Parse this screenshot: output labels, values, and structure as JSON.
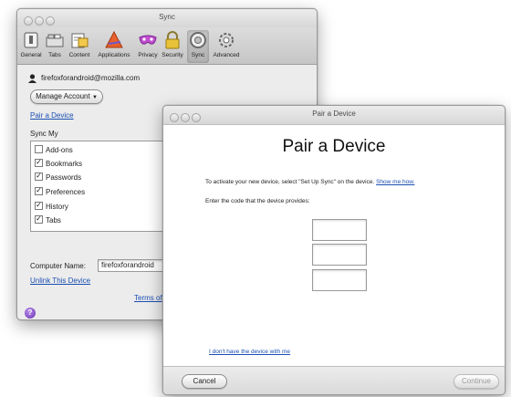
{
  "prefs": {
    "title": "Sync",
    "toolbar": [
      {
        "label": "General",
        "icon": "general-icon"
      },
      {
        "label": "Tabs",
        "icon": "tabs-icon"
      },
      {
        "label": "Content",
        "icon": "content-icon"
      },
      {
        "label": "Applications",
        "icon": "applications-icon"
      },
      {
        "label": "Privacy",
        "icon": "privacy-icon"
      },
      {
        "label": "Security",
        "icon": "security-icon"
      },
      {
        "label": "Sync",
        "icon": "sync-icon",
        "selected": true
      },
      {
        "label": "Advanced",
        "icon": "advanced-icon"
      }
    ],
    "account_email": "firefoxforandroid@mozilla.com",
    "manage_account_label": "Manage Account",
    "pair_device_link": "Pair a Device",
    "sync_my_label": "Sync My",
    "sync_items": [
      {
        "label": "Add-ons",
        "checked": false
      },
      {
        "label": "Bookmarks",
        "checked": true
      },
      {
        "label": "Passwords",
        "checked": true
      },
      {
        "label": "Preferences",
        "checked": true
      },
      {
        "label": "History",
        "checked": true
      },
      {
        "label": "Tabs",
        "checked": true
      }
    ],
    "computer_name_label": "Computer Name:",
    "computer_name_value": "firefoxforandroid",
    "unlink_link": "Unlink This Device",
    "terms_link": "Terms of",
    "help_label": "?"
  },
  "pair": {
    "title": "Pair a Device",
    "heading": "Pair a Device",
    "instruction_text": "To activate your new device, select \"Set Up Sync\" on the device.",
    "show_me_how_link": "Show me how.",
    "enter_code_text": "Enter the code that the device provides:",
    "code_fields": [
      "",
      "",
      ""
    ],
    "no_device_link": "I don't have the device with me",
    "cancel_label": "Cancel",
    "continue_label": "Continue"
  },
  "colors": {
    "link": "#1a4fb3",
    "help_purple": "#6a2fb6"
  }
}
